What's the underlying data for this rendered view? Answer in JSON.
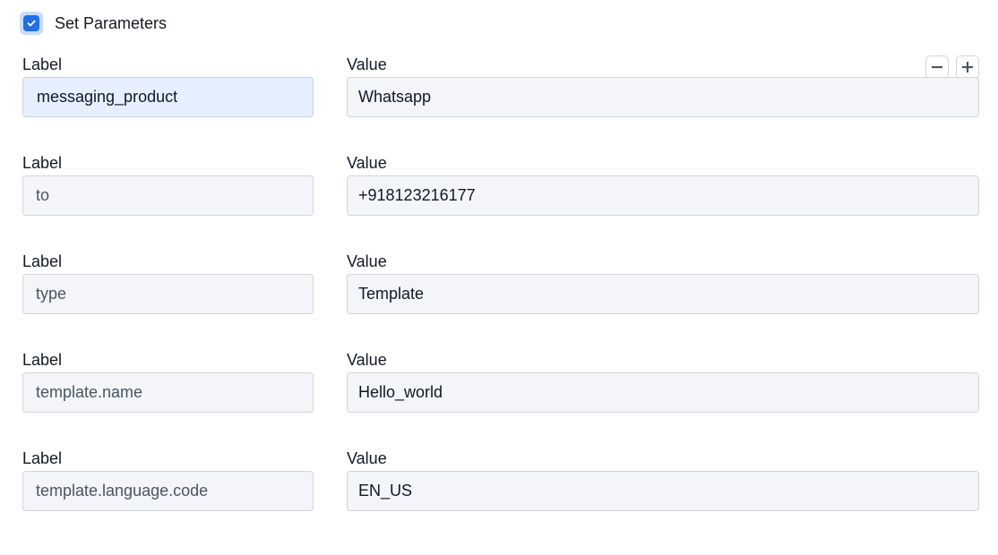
{
  "header": {
    "checked": true,
    "title": "Set Parameters"
  },
  "controls": {
    "remove_icon": "minus-icon",
    "add_icon": "plus-icon"
  },
  "colors": {
    "accent": "#1f6fe5",
    "input_bg": "#f3f5f8",
    "active_input_bg": "#e6efff"
  },
  "rows": [
    {
      "label_heading": "Label",
      "value_heading": "Value",
      "label": "messaging_product",
      "value": "Whatsapp"
    },
    {
      "label_heading": "Label",
      "value_heading": "Value",
      "label": "to",
      "value": "+918123216177"
    },
    {
      "label_heading": "Label",
      "value_heading": "Value",
      "label": "type",
      "value": "Template"
    },
    {
      "label_heading": "Label",
      "value_heading": "Value",
      "label": "template.name",
      "value": "Hello_world"
    },
    {
      "label_heading": "Label",
      "value_heading": "Value",
      "label": "template.language.code",
      "value": "EN_US"
    }
  ]
}
